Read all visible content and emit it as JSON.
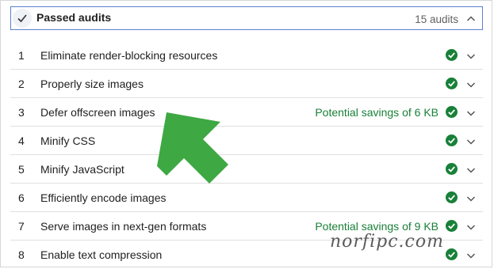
{
  "header": {
    "title": "Passed audits",
    "count": "15 audits",
    "check_icon": "checkmark-icon",
    "toggle_icon": "chevron-up-icon"
  },
  "audits": [
    {
      "num": "1",
      "title": "Eliminate render-blocking resources",
      "savings": ""
    },
    {
      "num": "2",
      "title": "Properly size images",
      "savings": ""
    },
    {
      "num": "3",
      "title": "Defer offscreen images",
      "savings": "Potential savings of 6 KB"
    },
    {
      "num": "4",
      "title": "Minify CSS",
      "savings": ""
    },
    {
      "num": "5",
      "title": "Minify JavaScript",
      "savings": ""
    },
    {
      "num": "6",
      "title": "Efficiently encode images",
      "savings": ""
    },
    {
      "num": "7",
      "title": "Serve images in next-gen formats",
      "savings": "Potential savings of 9 KB"
    },
    {
      "num": "8",
      "title": "Enable text compression",
      "savings": ""
    }
  ],
  "watermark": "norfipc.com",
  "colors": {
    "pass_green": "#188038",
    "header_border": "#5b7fcf",
    "arrow_green": "#3ea843",
    "savings_green": "#188038"
  },
  "icons": {
    "row_status": "pass-check-icon",
    "row_expand": "chevron-down-icon",
    "annotation": "arrow-pointer-icon"
  }
}
